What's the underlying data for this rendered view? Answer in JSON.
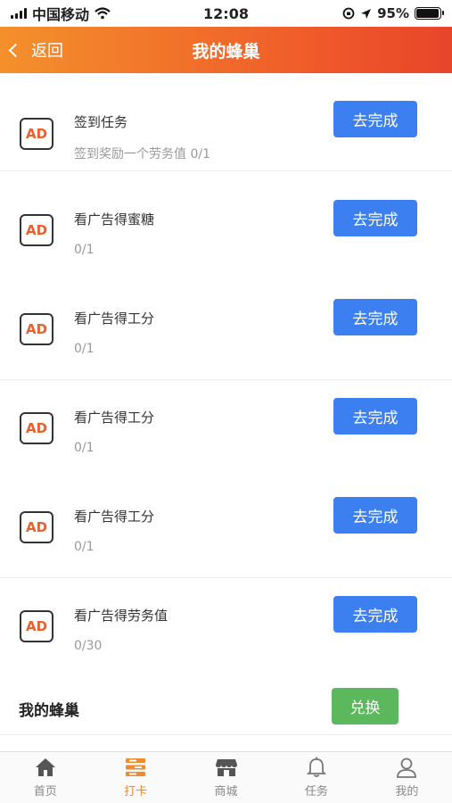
{
  "status_bar": {
    "carrier": "中国移动",
    "time": "12:08",
    "battery": "95%",
    "battery_level": 0.95
  },
  "header": {
    "back_label": "返回",
    "title": "我的蜂巢"
  },
  "tasks": [
    {
      "title": "签到任务",
      "subtitle": "签到奖励一个劳务值 0/1",
      "button": "去完成",
      "icon": "AD"
    },
    {
      "title": "看广告得蜜糖",
      "subtitle": "0/1",
      "button": "去完成",
      "icon": "AD"
    },
    {
      "title": "看广告得工分",
      "subtitle": "0/1",
      "button": "去完成",
      "icon": "AD"
    },
    {
      "title": "看广告得工分",
      "subtitle": "0/1",
      "button": "去完成",
      "icon": "AD"
    },
    {
      "title": "看广告得工分",
      "subtitle": "0/1",
      "button": "去完成",
      "icon": "AD"
    },
    {
      "title": "看广告得劳务值",
      "subtitle": "0/30",
      "button": "去完成",
      "icon": "AD"
    }
  ],
  "hive": {
    "label": "我的蜂巢",
    "button": "兑换"
  },
  "tabbar": {
    "items": [
      {
        "label": "首页",
        "icon": "home-icon"
      },
      {
        "label": "打卡",
        "icon": "checkin-icon",
        "active": true
      },
      {
        "label": "商城",
        "icon": "shop-icon"
      },
      {
        "label": "任务",
        "icon": "bell-icon"
      },
      {
        "label": "我的",
        "icon": "user-icon"
      }
    ]
  },
  "colors": {
    "accent": "#f08a2c",
    "button_blue": "#3b7ff0",
    "button_green": "#5cb85c"
  }
}
